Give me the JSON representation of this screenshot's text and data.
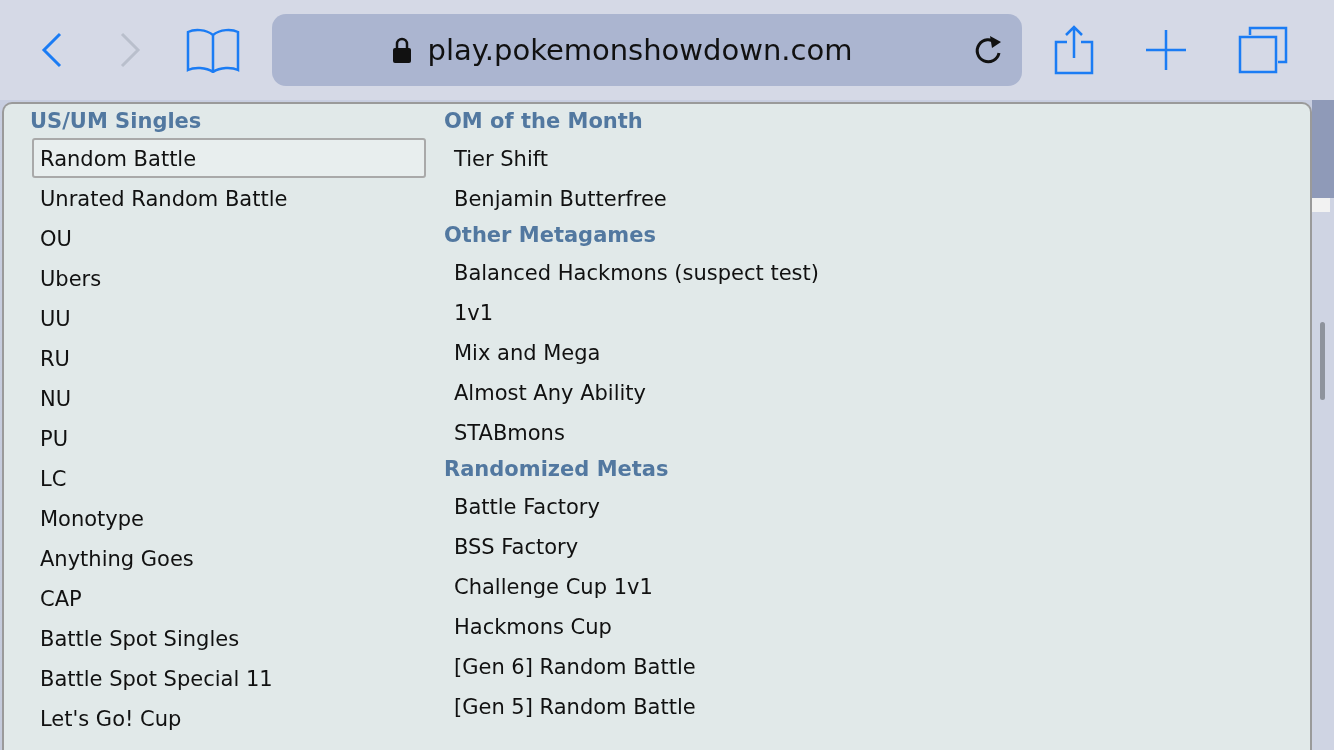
{
  "browser": {
    "nav": [
      {
        "kind": "back",
        "disabled": false
      },
      {
        "kind": "forward",
        "disabled": true
      }
    ],
    "url": "play.pokemonshowdown.com"
  },
  "format_menu": {
    "columns": [
      {
        "sections": [
          {
            "heading": "US/UM Singles",
            "items": [
              {
                "label": "Random Battle",
                "selected": true
              },
              {
                "label": "Unrated Random Battle",
                "selected": false
              },
              {
                "label": "OU",
                "selected": false
              },
              {
                "label": "Ubers",
                "selected": false
              },
              {
                "label": "UU",
                "selected": false
              },
              {
                "label": "RU",
                "selected": false
              },
              {
                "label": "NU",
                "selected": false
              },
              {
                "label": "PU",
                "selected": false
              },
              {
                "label": "LC",
                "selected": false
              },
              {
                "label": "Monotype",
                "selected": false
              },
              {
                "label": "Anything Goes",
                "selected": false
              },
              {
                "label": "CAP",
                "selected": false
              },
              {
                "label": "Battle Spot Singles",
                "selected": false
              },
              {
                "label": "Battle Spot Special 11",
                "selected": false
              },
              {
                "label": "Let's Go! Cup",
                "selected": false
              }
            ]
          }
        ]
      },
      {
        "sections": [
          {
            "heading": "OM of the Month",
            "items": [
              {
                "label": "Tier Shift",
                "selected": false
              },
              {
                "label": "Benjamin Butterfree",
                "selected": false
              }
            ]
          },
          {
            "heading": "Other Metagames",
            "items": [
              {
                "label": "Balanced Hackmons (suspect test)",
                "selected": false
              },
              {
                "label": "1v1",
                "selected": false
              },
              {
                "label": "Mix and Mega",
                "selected": false
              },
              {
                "label": "Almost Any Ability",
                "selected": false
              },
              {
                "label": "STABmons",
                "selected": false
              }
            ]
          },
          {
            "heading": "Randomized Metas",
            "items": [
              {
                "label": "Battle Factory",
                "selected": false
              },
              {
                "label": "BSS Factory",
                "selected": false
              },
              {
                "label": "Challenge Cup 1v1",
                "selected": false
              },
              {
                "label": "Hackmons Cup",
                "selected": false
              },
              {
                "label": "[Gen 6] Random Battle",
                "selected": false
              },
              {
                "label": "[Gen 5] Random Battle",
                "selected": false
              }
            ]
          }
        ]
      }
    ]
  }
}
